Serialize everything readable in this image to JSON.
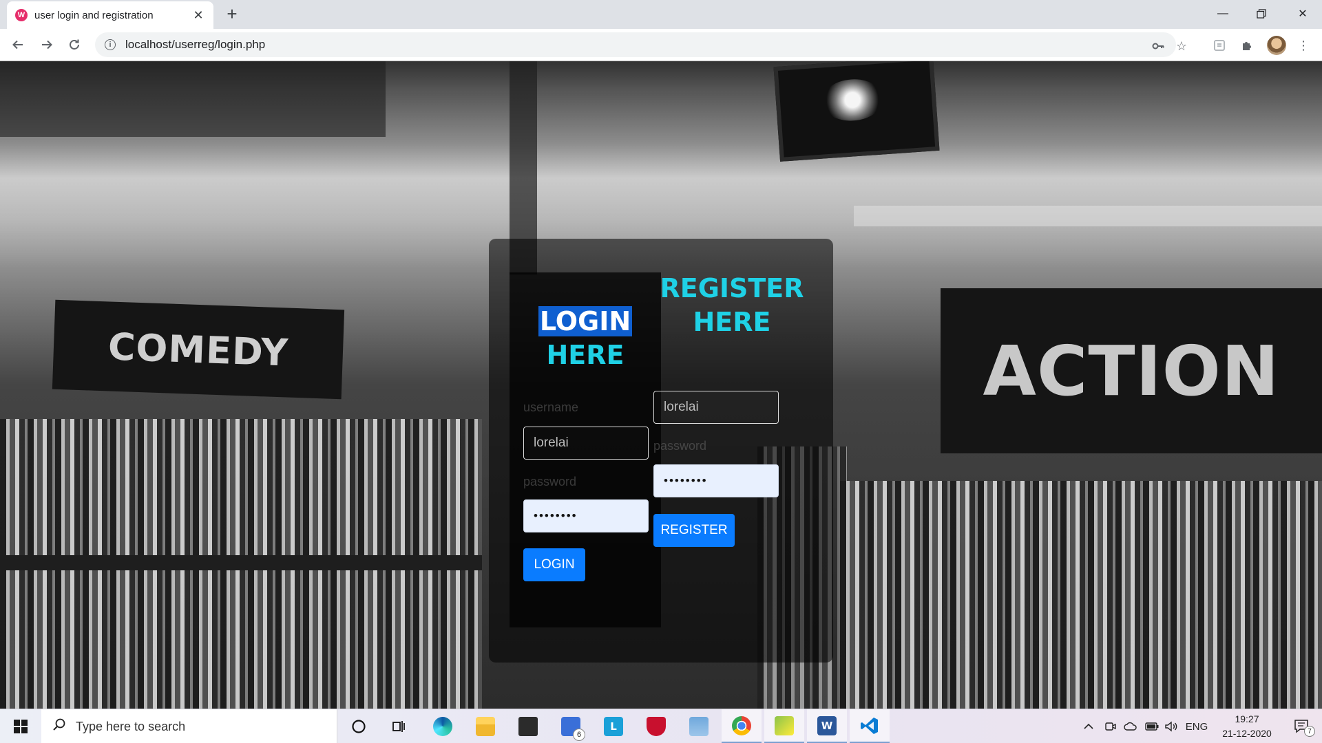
{
  "browser": {
    "tab_title": "user login and registration",
    "tab_favicon": "W",
    "url": "localhost/userreg/login.php",
    "new_tab_symbol": "+",
    "icons": [
      "back-icon",
      "forward-icon",
      "reload-icon",
      "info-icon",
      "key-icon",
      "star-icon",
      "extension-icon",
      "puzzle-icon",
      "profile-avatar",
      "menu-icon"
    ]
  },
  "background_signs": {
    "comedy": "COMEDY",
    "action": "ACTION"
  },
  "login": {
    "heading_line1": "LOGIN",
    "heading_line2": "HERE",
    "username_label": "username",
    "username_value": "lorelai",
    "password_label": "password",
    "password_value": "••••••••",
    "button_label": "LOGIN"
  },
  "register": {
    "heading_line1": "REGISTER",
    "heading_line2": "HERE",
    "username_value": "lorelai",
    "password_label": "password",
    "password_value": "••••••••",
    "button_label": "REGISTER"
  },
  "colors": {
    "heading": "#1fd1e6",
    "button": "#0a7cff",
    "highlight": "#0f5fd0"
  },
  "taskbar": {
    "search_placeholder": "Type here to search",
    "mail_badge": "6",
    "app_letters": {
      "l_app": "L",
      "word": "W"
    },
    "language": "ENG",
    "time": "19:27",
    "date": "21-12-2020",
    "notification_count": "7"
  }
}
